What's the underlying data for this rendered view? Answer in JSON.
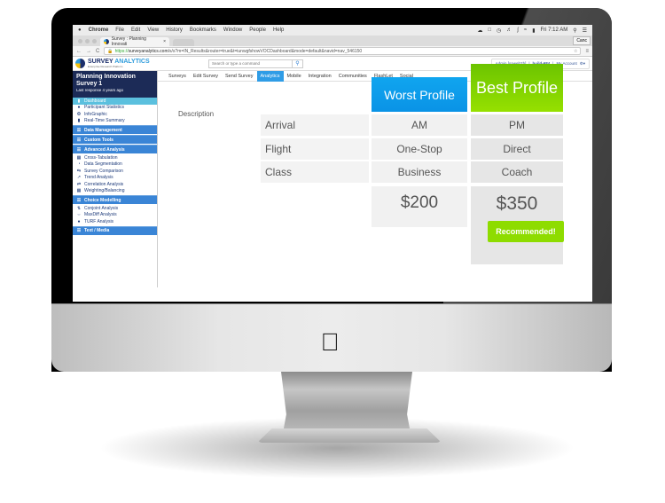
{
  "os_menubar": {
    "apple": "",
    "app": "Chrome",
    "items": [
      "File",
      "Edit",
      "View",
      "History",
      "Bookmarks",
      "Window",
      "People",
      "Help"
    ],
    "clock": "Fri 7:12 AM"
  },
  "browser": {
    "tab_title": "Survey : Planning Innovati",
    "tab_close": "×",
    "cancel_label": "Canc",
    "url_scheme": "https://",
    "url_host": "surveyanalytics.com",
    "url_path": "/s/s?m=IN_Results&router=true&t=iunwgfshowVOCDashboard&mode=default&navid=nav_546150",
    "nav_back": "←",
    "nav_forward": "→",
    "nav_reload": "C"
  },
  "app_header": {
    "logo_name_part1": "SURVEY",
    "logo_name_part2": "ANALYTICS",
    "logo_tagline": "Enterprise Research Platform",
    "search_placeholder": "Search or type a command",
    "account_user": "Admin [saweb2b]",
    "account_build": "build-684",
    "account_link": "My Account"
  },
  "project": {
    "title": "Planning Innovation Survey 1",
    "subtitle": "Last response 4 years ago"
  },
  "sidebar": {
    "dashboard": "Dashboard",
    "participant_statistics": "Participant Statistics",
    "infographic": "InfoGraphic",
    "realtime_summary": "Real-Time Summary",
    "data_management": "Data Management",
    "custom_tools": "Custom Tools",
    "advanced_analysis": "Advanced Analysis",
    "cross_tabulation": "Cross-Tabulation",
    "data_segmentation": "Data Segmentation",
    "survey_comparison": "Survey Comparison",
    "trend_analysis": "Trend Analysis",
    "correlation_analysis": "Correlation Analysis",
    "weighting_balancing": "Weighting/Balancing",
    "choice_modelling": "Choice Modelling",
    "conjoint_analysis": "Conjoint Analysis",
    "maxdiff_analysis": "MaxDiff Analysis",
    "turf_analysis": "TURF Analysis",
    "text_media": "Text / Media"
  },
  "nav_tabs": [
    "Surveys",
    "Edit Survey",
    "Send Survey",
    "Analytics",
    "Mobile",
    "Integration",
    "Communities",
    "FlashLet",
    "Social"
  ],
  "active_tab": "Analytics",
  "comparison": {
    "description_label": "Description",
    "worst_header": "Worst Profile",
    "best_header": "Best Profile",
    "rows": [
      {
        "attribute": "Arrival",
        "worst": "AM",
        "best": "PM"
      },
      {
        "attribute": "Flight",
        "worst": "One-Stop",
        "best": "Direct"
      },
      {
        "attribute": "Class",
        "worst": "Business",
        "best": "Coach"
      }
    ],
    "worst_price": "$200",
    "best_price": "$350",
    "recommended_label": "Recommended!"
  },
  "colors": {
    "worst_header": "#0a9aea",
    "best_header": "#7fd000",
    "recommended": "#8edc00",
    "sidebar_section": "#3a85d6",
    "project_header": "#1c2b57",
    "active_nav": "#2f9ce6"
  }
}
